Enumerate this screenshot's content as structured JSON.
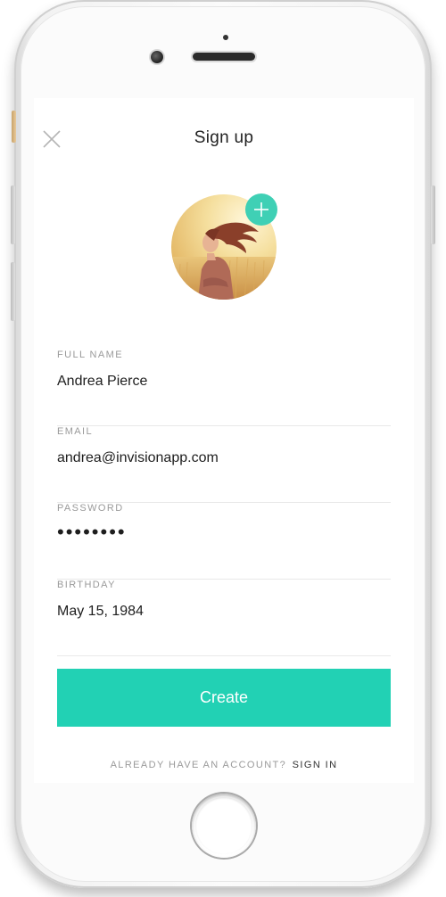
{
  "header": {
    "title": "Sign up",
    "close_icon": "close-icon"
  },
  "avatar": {
    "add_icon": "plus-icon",
    "accent_color": "#3fd0b5"
  },
  "form": {
    "full_name": {
      "label": "FULL NAME",
      "value": "Andrea Pierce"
    },
    "email": {
      "label": "EMAIL",
      "value": "andrea@invisionapp.com"
    },
    "password": {
      "label": "PASSWORD",
      "value": "••••••••"
    },
    "birthday": {
      "label": "BIRTHDAY",
      "value": "May 15, 1984"
    }
  },
  "actions": {
    "create_label": "Create",
    "button_color": "#22d1b4"
  },
  "footer": {
    "prompt": "ALREADY HAVE AN ACCOUNT?",
    "sign_in_label": "SIGN IN"
  }
}
